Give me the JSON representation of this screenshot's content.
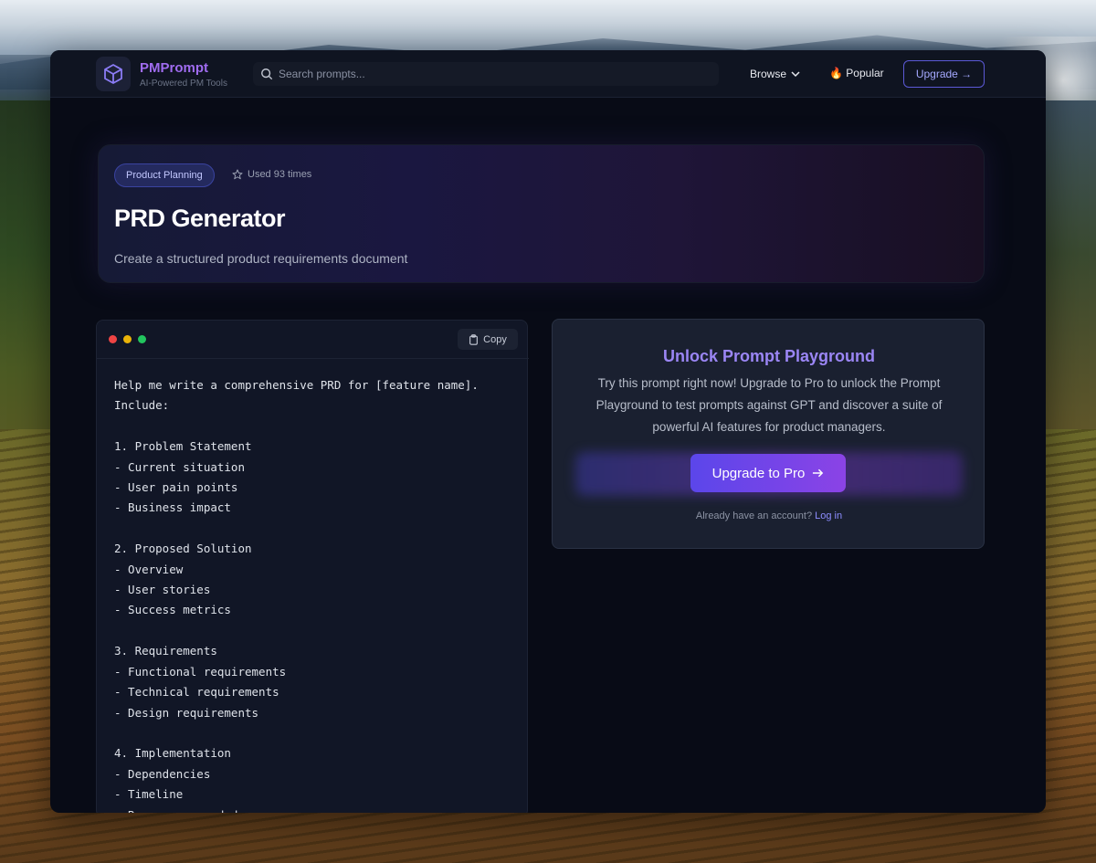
{
  "app": {
    "brand": "PMPrompt",
    "tagline": "AI-Powered PM Tools"
  },
  "nav": {
    "search_placeholder": "Search prompts...",
    "browse_label": "Browse",
    "popular_icon": "🔥",
    "popular_label": "Popular",
    "upgrade_label": "Upgrade →"
  },
  "hero": {
    "category": "Product Planning",
    "usage": "Used 93 times",
    "title": "PRD Generator",
    "description": "Create a structured product requirements document"
  },
  "editor": {
    "copy_label": "Copy",
    "window_dot_colors": [
      "#ef4444",
      "#eab308",
      "#22c55e"
    ],
    "prompt_text": "Help me write a comprehensive PRD for [feature name].\nInclude:\n\n1. Problem Statement\n- Current situation\n- User pain points\n- Business impact\n\n2. Proposed Solution\n- Overview\n- User stories\n- Success metrics\n\n3. Requirements\n- Functional requirements\n- Technical requirements\n- Design requirements\n\n4. Implementation\n- Dependencies\n- Timeline\n- Resources needed"
  },
  "upsell": {
    "title": "Unlock Prompt Playground",
    "body": "Try this prompt right now! Upgrade to Pro to unlock the Prompt Playground to test prompts against GPT and discover a suite of powerful AI features for product managers.",
    "button_label": "Upgrade to Pro",
    "account_text": "Already have an account?",
    "login_label": "Log in"
  },
  "icons": {
    "logo": "cube-icon",
    "search": "search-icon",
    "browse": "chevron-down-icon",
    "usage": "star-icon",
    "copy": "clipboard-icon",
    "upgrade": "arrow-right-icon"
  },
  "colors": {
    "brand": "#a06cf0",
    "accent": "#5b46ea",
    "background": "#080b16"
  }
}
